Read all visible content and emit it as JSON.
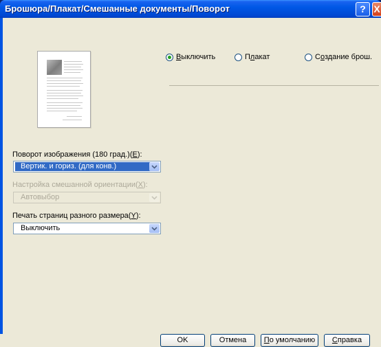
{
  "window": {
    "title": "Брошюра/Плакат/Смешанные документы/Поворот",
    "help_glyph": "?",
    "close_glyph": "X"
  },
  "mode": {
    "options": [
      {
        "label_pre": "",
        "label_u": "В",
        "label_post": "ыключить",
        "checked": true
      },
      {
        "label_pre": "П",
        "label_u": "л",
        "label_post": "акат",
        "checked": false
      },
      {
        "label_pre": "С",
        "label_u": "о",
        "label_post": "здание брош.",
        "checked": false
      }
    ]
  },
  "rotation": {
    "label_pre": "Поворот изображения (180 град.)(",
    "label_u": "E",
    "label_post": "):",
    "value": "Вертик. и гориз. (для конв.)"
  },
  "mixed_orientation": {
    "label_pre": "Настройка смешанной ориентации(",
    "label_u": "X",
    "label_post": "):",
    "value": "Автовыбор",
    "enabled": false
  },
  "mixed_size": {
    "label_pre": "Печать страниц разного размера(",
    "label_u": "Y",
    "label_post": "):",
    "value": "Выключить"
  },
  "buttons": {
    "ok": {
      "pre": "",
      "u": "",
      "post": "OK"
    },
    "cancel": {
      "pre": "",
      "u": "",
      "post": "Отмена"
    },
    "defaults": {
      "pre": "",
      "u": "П",
      "post": "о умолчанию"
    },
    "help": {
      "pre": "",
      "u": "С",
      "post": "правка"
    }
  }
}
